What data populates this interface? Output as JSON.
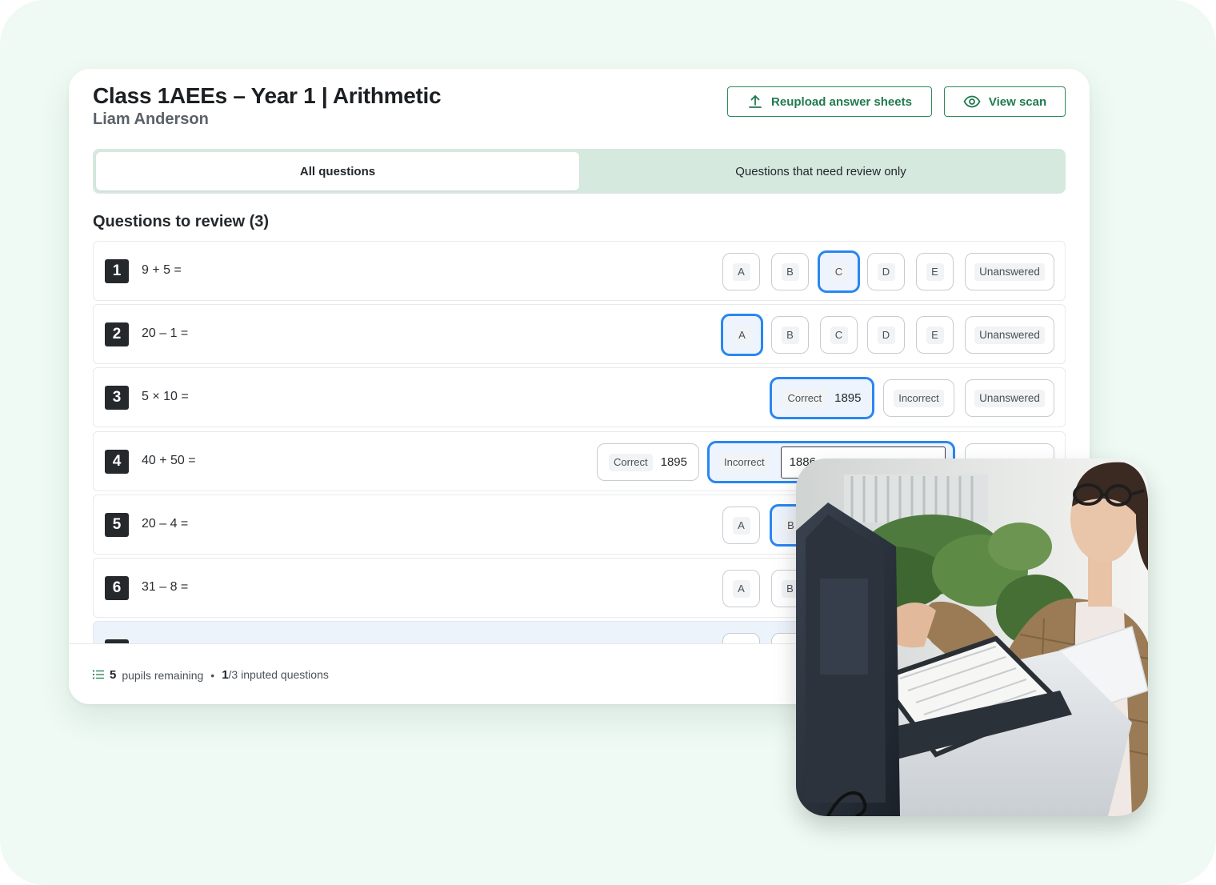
{
  "header": {
    "title": "Class 1AEEs – Year 1 | Arithmetic",
    "student": "Liam Anderson",
    "reupload_label": "Reupload answer sheets",
    "view_scan_label": "View scan"
  },
  "tabs": [
    {
      "label": "All questions",
      "active": true
    },
    {
      "label": "Questions that need review only",
      "active": false
    }
  ],
  "section_heading": "Questions to review (3)",
  "questions": [
    {
      "number": "1",
      "text": "9 + 5 =",
      "options": [
        "A",
        "B",
        "C",
        "D",
        "E"
      ],
      "selected": "C",
      "unanswered_label": "Unanswered"
    },
    {
      "number": "2",
      "text": "20 – 1 =",
      "options": [
        "A",
        "B",
        "C",
        "D",
        "E"
      ],
      "selected": "A",
      "unanswered_label": "Unanswered"
    },
    {
      "number": "3",
      "text": "5 × 10 =",
      "correct_label": "Correct",
      "correct_value": "1895",
      "incorrect_label": "Incorrect",
      "unanswered_label": "Unanswered",
      "selected": "Correct"
    },
    {
      "number": "4",
      "text": "40 + 50 =",
      "correct_label": "Correct",
      "correct_value": "1895",
      "incorrect_label": "Incorrect",
      "incorrect_value": "1886",
      "selected": "Incorrect"
    },
    {
      "number": "5",
      "text": "20 – 4 =",
      "options": [
        "A",
        "B"
      ],
      "selected": "B"
    },
    {
      "number": "6",
      "text": "31 – 8 =",
      "options": [
        "A",
        "B"
      ]
    }
  ],
  "footer": {
    "pupils_count": "5",
    "pupils_label": "pupils remaining",
    "separator": "•",
    "inputed_count": "1",
    "inputed_label": "/3 inputed questions"
  },
  "colors": {
    "background": "#eefaf3",
    "brand_green": "#1f7a4d",
    "tabs_track": "#d6e9df",
    "selection_blue": "#2a86f0"
  },
  "icons": [
    "upload-icon",
    "eye-icon",
    "list-icon"
  ]
}
